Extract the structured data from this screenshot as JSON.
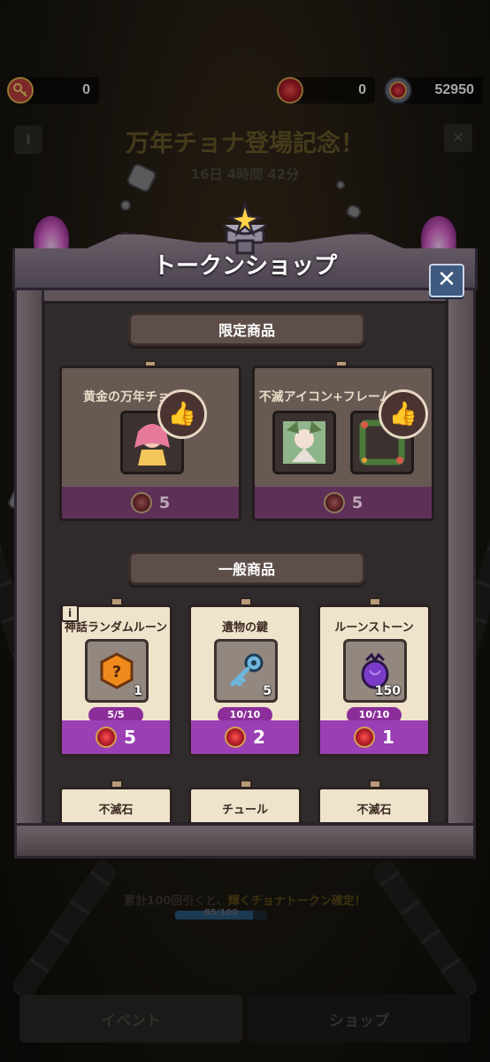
{
  "currencies": {
    "key_count": "0",
    "token_count": "0",
    "gem_count": "52950"
  },
  "event": {
    "title": "万年チョナ登場記念！",
    "timer": "16日 4時間 42分",
    "info_label": "i",
    "close_label": "✕"
  },
  "progress": {
    "text_prefix": "累計100回引くと、",
    "text_highlight": "輝くチョナトークン確定！",
    "count": "85/100",
    "fraction": 0.85
  },
  "bottom_nav": {
    "event_tab": "イベント",
    "shop_tab": "ショップ"
  },
  "modal": {
    "title": "トークンショップ",
    "close_label": "✕"
  },
  "limited_section": {
    "title": "限定商品",
    "items": [
      {
        "name": "黄金の万年チョナ",
        "price": "5"
      },
      {
        "name": "不滅アイコン+フレーム",
        "price": "5"
      }
    ]
  },
  "general_section": {
    "title": "一般商品",
    "items": [
      {
        "name": "神話ランダムルーン",
        "qty": "1",
        "limit": "5/5",
        "price": "5"
      },
      {
        "name": "遺物の鍵",
        "qty": "5",
        "limit": "10/10",
        "price": "2"
      },
      {
        "name": "ルーンストーン",
        "qty": "150",
        "limit": "10/10",
        "price": "1"
      }
    ],
    "more_items": [
      {
        "name": "不滅石"
      },
      {
        "name": "チュール"
      },
      {
        "name": "不滅石"
      }
    ],
    "info_label": "i"
  },
  "colors": {
    "card_bg": "#efe3cb",
    "price_bar": "#9b3fb5",
    "limit_badge": "#8b2e9a",
    "token_red": "#d0202e",
    "close_blue": "#3e5a80"
  }
}
